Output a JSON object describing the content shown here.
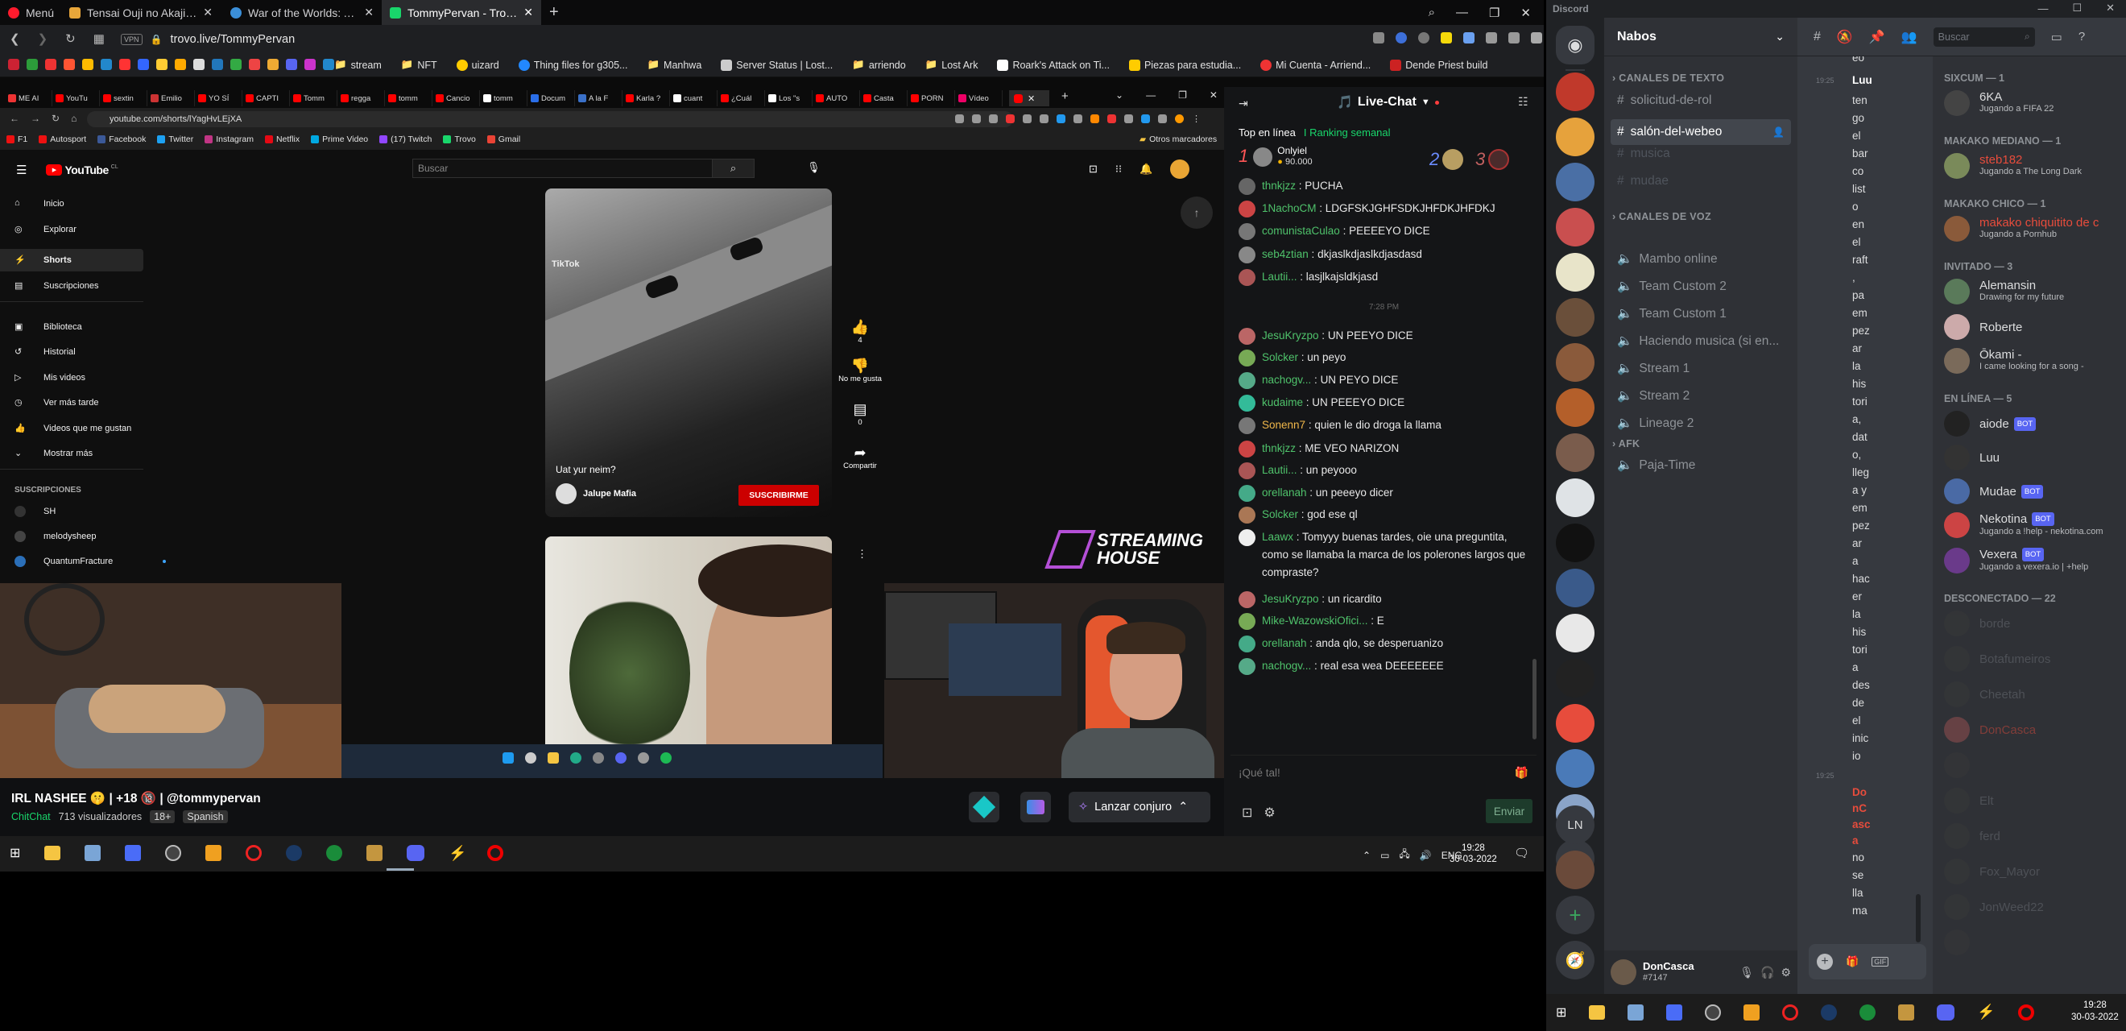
{
  "opera": {
    "menu": "Menú",
    "tabs": [
      {
        "label": "Tensai Ouji no Akaji Kokka"
      },
      {
        "label": "War of the Worlds: Annihila"
      },
      {
        "label": "TommyPervan - Trovo"
      }
    ],
    "vpn": "VPN",
    "url": "trovo.live/TommyPervan",
    "bookmarks": [
      "stream",
      "NFT",
      "uizard",
      "Thing files for g305...",
      "Manhwa",
      "Server Status | Lost...",
      "arriendo",
      "Lost Ark",
      "Roark's Attack on Ti...",
      "Piezas para estudia...",
      "Mi Cuenta - Arriend...",
      "Dende Priest build"
    ]
  },
  "chrome": {
    "tabs": [
      "ME AI",
      "YouTu",
      "sextin",
      "Emilio",
      "YO SÍ",
      "CAPTI",
      "Tomm",
      "regga",
      "tomm",
      "Cancio",
      "tomm",
      "Docum",
      "A la F",
      "Karla ?",
      "cuant",
      "¿Cuál",
      "Los \"s",
      "AUTO",
      "Casta",
      "PORN",
      "Vídeo"
    ],
    "url": "youtube.com/shorts/lYagHvLEjXA",
    "bookmarks": [
      "F1",
      "Autosport",
      "Facebook",
      "Twitter",
      "Instagram",
      "Netflix",
      "Prime Video",
      "(17) Twitch",
      "Trovo",
      "Gmail"
    ],
    "other_bookmarks": "Otros marcadores"
  },
  "youtube": {
    "logo": "YouTube",
    "logo_country": "CL",
    "search_placeholder": "Buscar",
    "nav": [
      "Inicio",
      "Explorar",
      "Shorts",
      "Suscripciones",
      "Biblioteca",
      "Historial",
      "Mis videos",
      "Ver más tarde",
      "Videos que me gustan",
      "Mostrar más"
    ],
    "subs_header": "SUSCRIPCIONES",
    "subs": [
      "SH",
      "melodysheep",
      "QuantumFracture"
    ],
    "short": {
      "caption": "Uat yur neim?",
      "channel": "Jalupe Mafia",
      "subscribe": "SUSCRIBIRME",
      "likes": "4",
      "dislike": "No me gusta",
      "comments": "0",
      "share": "Compartir",
      "watermark": "TikTok"
    }
  },
  "stream": {
    "overlay_title": "STREAMING HOUSE",
    "title": "IRL NASHEE 🤫 | +18 🔞 | @tommypervan",
    "category": "ChitChat",
    "viewers": "713 visualizadores",
    "age": "18+",
    "lang": "Spanish",
    "spell": "Lanzar conjuro"
  },
  "trovo": {
    "header": "Live-Chat",
    "top_label": "Top en línea",
    "ranking": "Ranking semanal",
    "top1": {
      "rank": "1",
      "name": "Onlyiel",
      "points": "90.000"
    },
    "top2": "2",
    "top3": "3",
    "messages": [
      {
        "user": "thnkjzz",
        "text": "PUCHA",
        "color": "#4fc26b"
      },
      {
        "user": "1NachoCM",
        "text": "LDGFSKJGHFSDKJHFDKJHFDKJ",
        "color": "#4fc26b"
      },
      {
        "user": "comunistaCulao",
        "text": "PEEEEYO DICE",
        "color": "#4fc26b"
      },
      {
        "user": "seb4ztian",
        "text": "dkjaslkdjaslkdjasdasd",
        "color": "#4fc26b"
      },
      {
        "user": "Lautii...",
        "text": "lasjlkajsldkjasd",
        "color": "#4fc26b"
      },
      {
        "user": "JesuKryzpo",
        "text": "UN PEEYO DICE",
        "color": "#4fc26b"
      },
      {
        "user": "Solcker",
        "text": "un peyo",
        "color": "#4fc26b"
      },
      {
        "user": "nachogv...",
        "text": "UN PEYO DICE",
        "color": "#4fc26b"
      },
      {
        "user": "kudaime",
        "text": "UN PEEEYO DICE",
        "color": "#4fc26b"
      },
      {
        "user": "Sonenn7",
        "text": "quien le dio droga la llama",
        "color": "#f0b74a"
      },
      {
        "user": "thnkjzz",
        "text": "ME VEO NARIZON",
        "color": "#4fc26b"
      },
      {
        "user": "Lautii...",
        "text": "un peyooo",
        "color": "#4fc26b"
      },
      {
        "user": "orellanah",
        "text": "un peeeyo dicer",
        "color": "#4fc26b"
      },
      {
        "user": "Solcker",
        "text": "god ese ql",
        "color": "#4fc26b"
      },
      {
        "user": "Laawx",
        "text": "Tomyyy buenas tardes, oie una preguntita, como se llamaba la marca de los polerones largos que compraste?",
        "color": "#4fc26b"
      },
      {
        "user": "JesuKryzpo",
        "text": "un ricardito",
        "color": "#4fc26b"
      },
      {
        "user": "Mike-WazowskiOfici...",
        "text": "E",
        "color": "#4fc26b"
      },
      {
        "user": "orellanah",
        "text": "anda qlo, se desperuanizo",
        "color": "#4fc26b"
      },
      {
        "user": "nachogv...",
        "text": "real esa wea DEEEEEEE",
        "color": "#4fc26b"
      }
    ],
    "time": "7:28 PM",
    "input_placeholder": "¡Qué tal!",
    "send": "Enviar"
  },
  "taskbar_left": {
    "lang": "ENG",
    "time": "19:28",
    "date": "30-03-2022"
  },
  "discord": {
    "app": "Discord",
    "server": "Nabos",
    "search": "Buscar",
    "text_cat": "CANALES DE TEXTO",
    "text_channels": [
      "solicitud-de-rol",
      "salón-del-webeo",
      "musica",
      "mudae"
    ],
    "voice_cat": "CANALES DE VOZ",
    "voice_channels": [
      "Mambo online",
      "Team Custom 2",
      "Team Custom 1",
      "Haciendo musica (si en...",
      "Stream 1",
      "Stream 2",
      "Lineage 2"
    ],
    "afk_cat": "AFK",
    "afk_channels": [
      "Paja-Time"
    ],
    "guild_ln": "LN",
    "msg_time1": "19:25",
    "msg_user": "Luu",
    "msg_text": [
      "eo",
      "ten",
      "go",
      "el",
      "bar",
      "co",
      "list",
      "o",
      "en",
      "el",
      "raft",
      ",",
      "pa",
      "em",
      "pez",
      "ar",
      "la",
      "his",
      "tori",
      "a,",
      "dat",
      "o,",
      "lleg",
      "a y",
      "em",
      "pez",
      "ar",
      "a",
      "hac",
      "er",
      "la",
      "his",
      "tori",
      "a",
      "des",
      "de",
      "el",
      "inic",
      "io"
    ],
    "msg_time2": "19:25",
    "msg_user2": "DonCasca",
    "msg_text2": [
      "no",
      "se",
      "lla",
      "ma"
    ],
    "members": {
      "sections": [
        {
          "header": "SIXCUM — 1",
          "items": [
            {
              "name": "6KA",
              "status": "Jugando a FIFA 22",
              "color": "#dcddde"
            }
          ]
        },
        {
          "header": "MAKAKO MEDIANO — 1",
          "items": [
            {
              "name": "steb182",
              "status": "Jugando a The Long Dark",
              "color": "#e74c3c"
            }
          ]
        },
        {
          "header": "MAKAKO CHICO — 1",
          "items": [
            {
              "name": "makako chiquitito de c",
              "status": "Jugando a Pornhub",
              "color": "#e74c3c"
            }
          ]
        },
        {
          "header": "INVITADO — 3",
          "items": [
            {
              "name": "Alemansin",
              "status": "Drawing for my future",
              "color": "#dcddde"
            },
            {
              "name": "Roberte",
              "status": "",
              "color": "#dcddde"
            },
            {
              "name": "Ōkami -",
              "status": "I came looking for a song -",
              "color": "#dcddde"
            }
          ]
        },
        {
          "header": "EN LÍNEA — 5",
          "items": [
            {
              "name": "aiode",
              "status": "",
              "color": "#dcddde",
              "badge": "BOT"
            },
            {
              "name": "Luu",
              "status": "",
              "color": "#dcddde"
            },
            {
              "name": "Mudae",
              "status": "",
              "color": "#dcddde",
              "badge": "BOT"
            },
            {
              "name": "Nekotina",
              "status": "Jugando a !help - nekotina.com",
              "color": "#dcddde",
              "badge": "BOT"
            },
            {
              "name": "Vexera",
              "status": "Jugando a vexera.io | +help",
              "color": "#dcddde",
              "badge": "BOT"
            }
          ]
        },
        {
          "header": "DESCONECTADO — 22",
          "items": [
            {
              "name": "borde",
              "status": "",
              "color": "#72767d"
            },
            {
              "name": "Botafumeiros",
              "status": "",
              "color": "#72767d"
            },
            {
              "name": "Cheetah",
              "status": "",
              "color": "#72767d"
            },
            {
              "name": "DonCasca",
              "status": "",
              "color": "#e74c3c"
            },
            {
              "name": "",
              "status": "",
              "color": "#72767d"
            },
            {
              "name": "Elt",
              "status": "",
              "color": "#72767d"
            },
            {
              "name": "ferd",
              "status": "",
              "color": "#72767d"
            },
            {
              "name": "Fox_Mayor",
              "status": "",
              "color": "#72767d"
            },
            {
              "name": "JonWeed22",
              "status": "",
              "color": "#72767d"
            },
            {
              "name": "",
              "status": "",
              "color": "#72767d"
            }
          ]
        }
      ]
    },
    "user": {
      "name": "DonCasca",
      "tag": "#7147"
    }
  },
  "taskbar_right": {
    "time": "19:28",
    "date": "30-03-2022"
  }
}
